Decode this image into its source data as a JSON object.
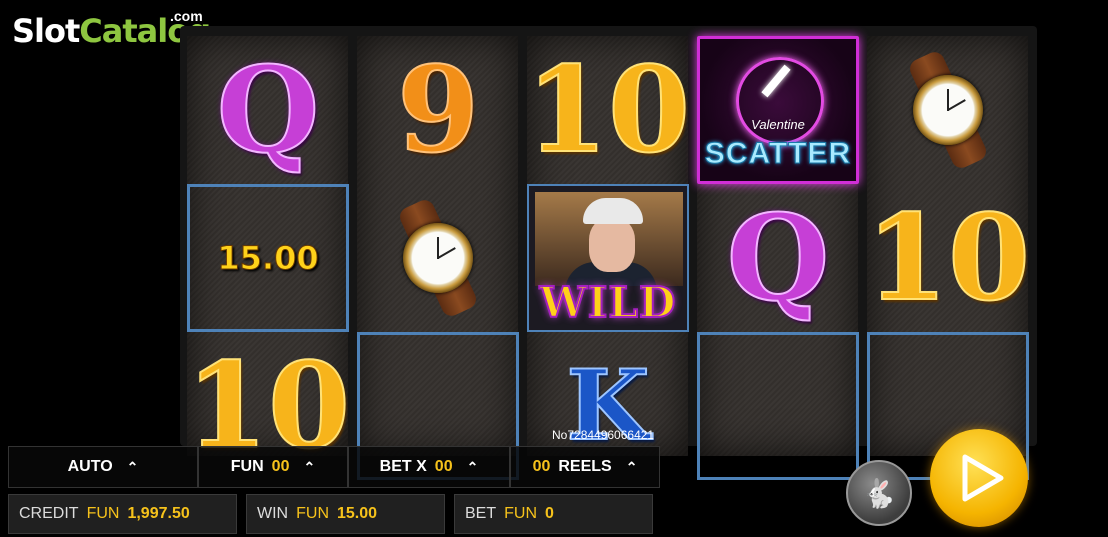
{
  "brand": {
    "slot": "Slot",
    "catalog": "Catalog",
    "com": ".com"
  },
  "reels": {
    "r1": {
      "top": "Q",
      "middle_win": "15.00",
      "bottom": "10"
    },
    "r2": {
      "top": "9",
      "middle": "watch",
      "bottom": ""
    },
    "r3": {
      "top": "10",
      "middle_wild": "WILD",
      "bottom": "K"
    },
    "r4": {
      "top_scatter_brand": "Valentine",
      "top_scatter": "SCATTER",
      "middle": "Q",
      "bottom": ""
    },
    "r5": {
      "top": "watch",
      "middle": "10",
      "bottom": ""
    }
  },
  "serial": "No7284496066421",
  "controls": {
    "auto": "AUTO",
    "fun_label": "FUN",
    "fun_value": "00",
    "bet_label": "BET X",
    "bet_value": "00",
    "reels_value": "00",
    "reels_label": "REELS",
    "caret": "⌃"
  },
  "info": {
    "credit_label": "CREDIT",
    "credit_currency": "FUN",
    "credit_value": "1,997.50",
    "win_label": "WIN",
    "win_currency": "FUN",
    "win_value": "15.00",
    "bet_label": "BET",
    "bet_currency": "FUN",
    "bet_value": "0"
  },
  "icons": {
    "turbo": "rabbit-icon",
    "spin": "play-icon"
  },
  "colors": {
    "accent": "#f6c21b",
    "frame": "#4e82b8",
    "scatter": "#d12ed7"
  }
}
